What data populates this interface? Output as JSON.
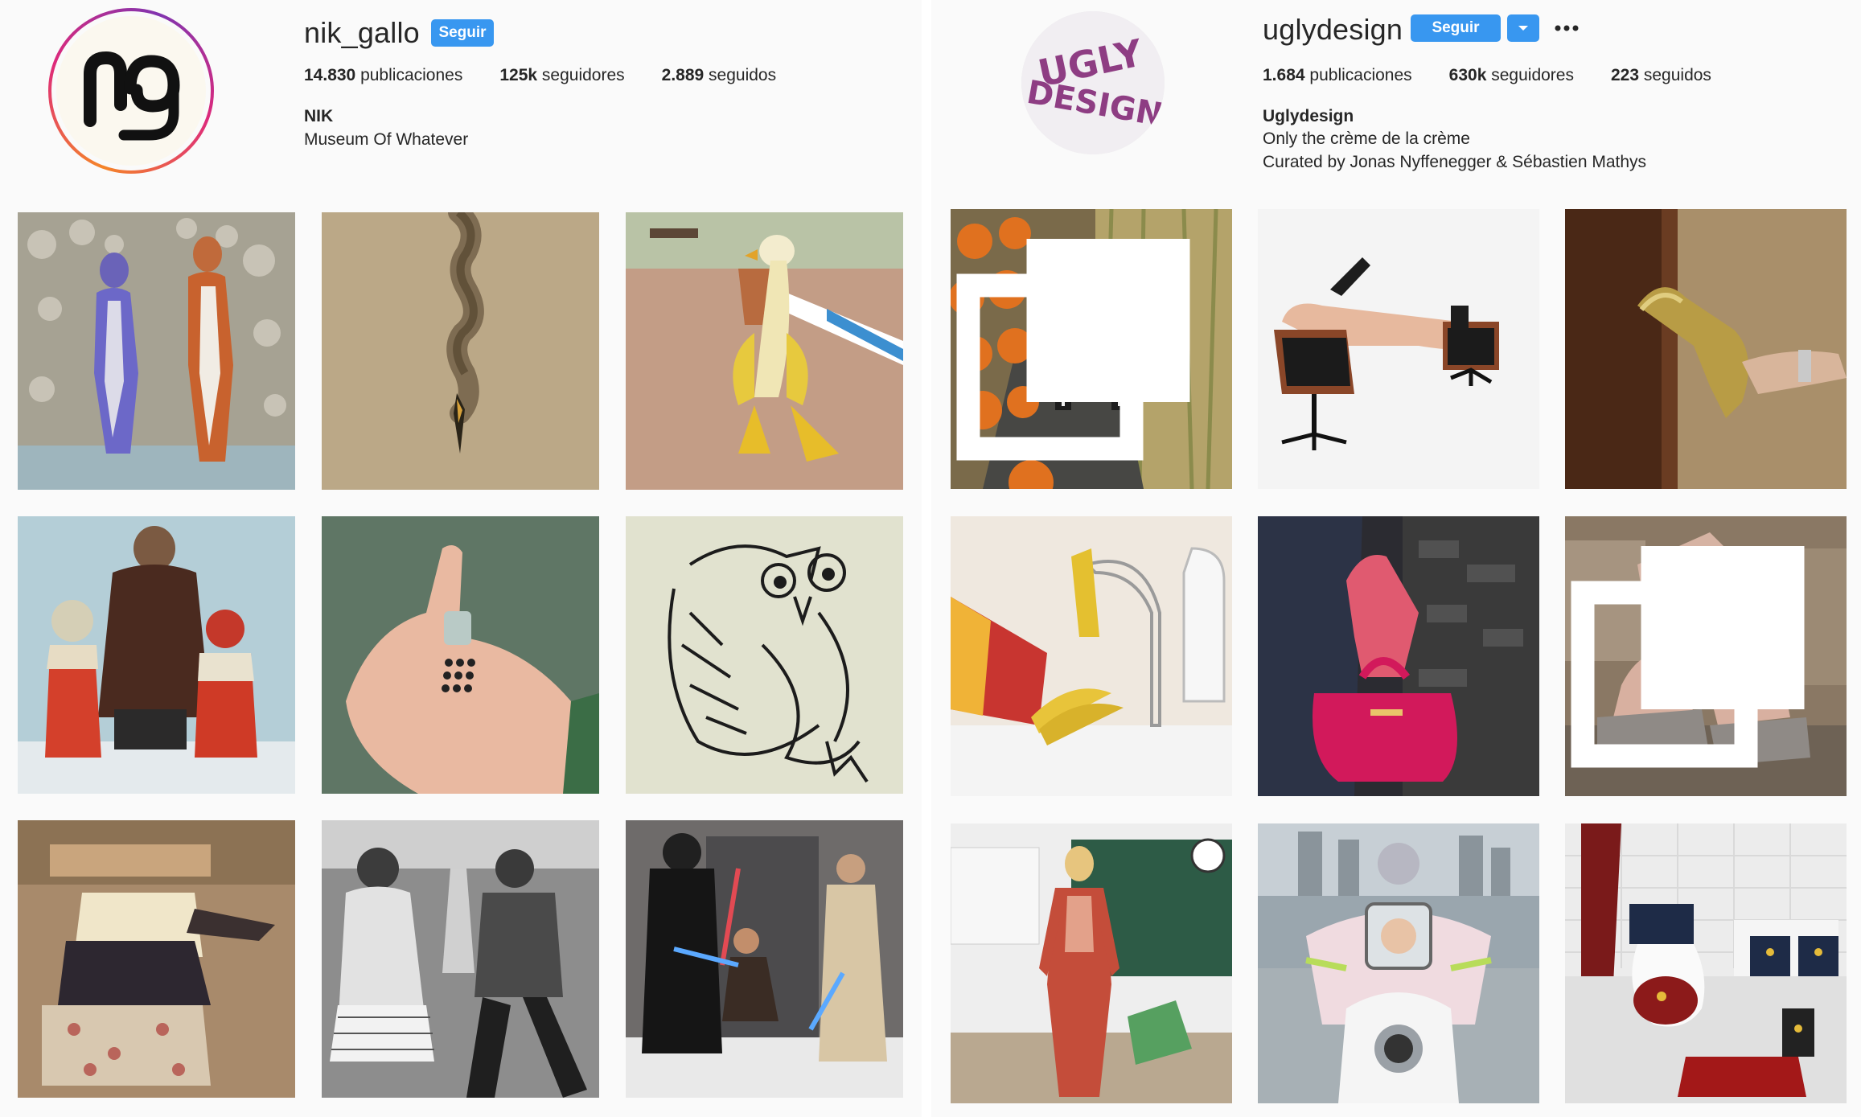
{
  "profiles": [
    {
      "username": "nik_gallo",
      "follow_label": "Seguir",
      "avatar_text": "ng",
      "stats": {
        "posts_value": "14.830",
        "posts_label": "publicaciones",
        "followers_value": "125k",
        "followers_label": "seguidores",
        "following_value": "2.889",
        "following_label": "seguidos"
      },
      "bio": {
        "name": "NIK",
        "lines": [
          "Museum Of Whatever"
        ]
      },
      "avatar_ring_colors": [
        "#f58529",
        "#dd2a7b",
        "#8134af"
      ]
    },
    {
      "username": "uglydesign",
      "follow_label": "Seguir",
      "avatar_lines": [
        "UGLY",
        "DESIGN"
      ],
      "stats": {
        "posts_value": "1.684",
        "posts_label": "publicaciones",
        "followers_value": "630k",
        "followers_label": "seguidores",
        "following_value": "223",
        "following_label": "seguidos"
      },
      "bio": {
        "name": "Uglydesign",
        "lines": [
          "Only the crème de la crème",
          "Curated by Jonas Nyffenegger & Sébastien Mathys"
        ]
      }
    }
  ],
  "colors": {
    "accent": "#3897f0",
    "text": "#262626",
    "panel": "#fafafa"
  },
  "icons": {
    "dropdown": "chevron-down-icon",
    "more": "more-options-icon",
    "multi": "multiple-posts-icon"
  }
}
